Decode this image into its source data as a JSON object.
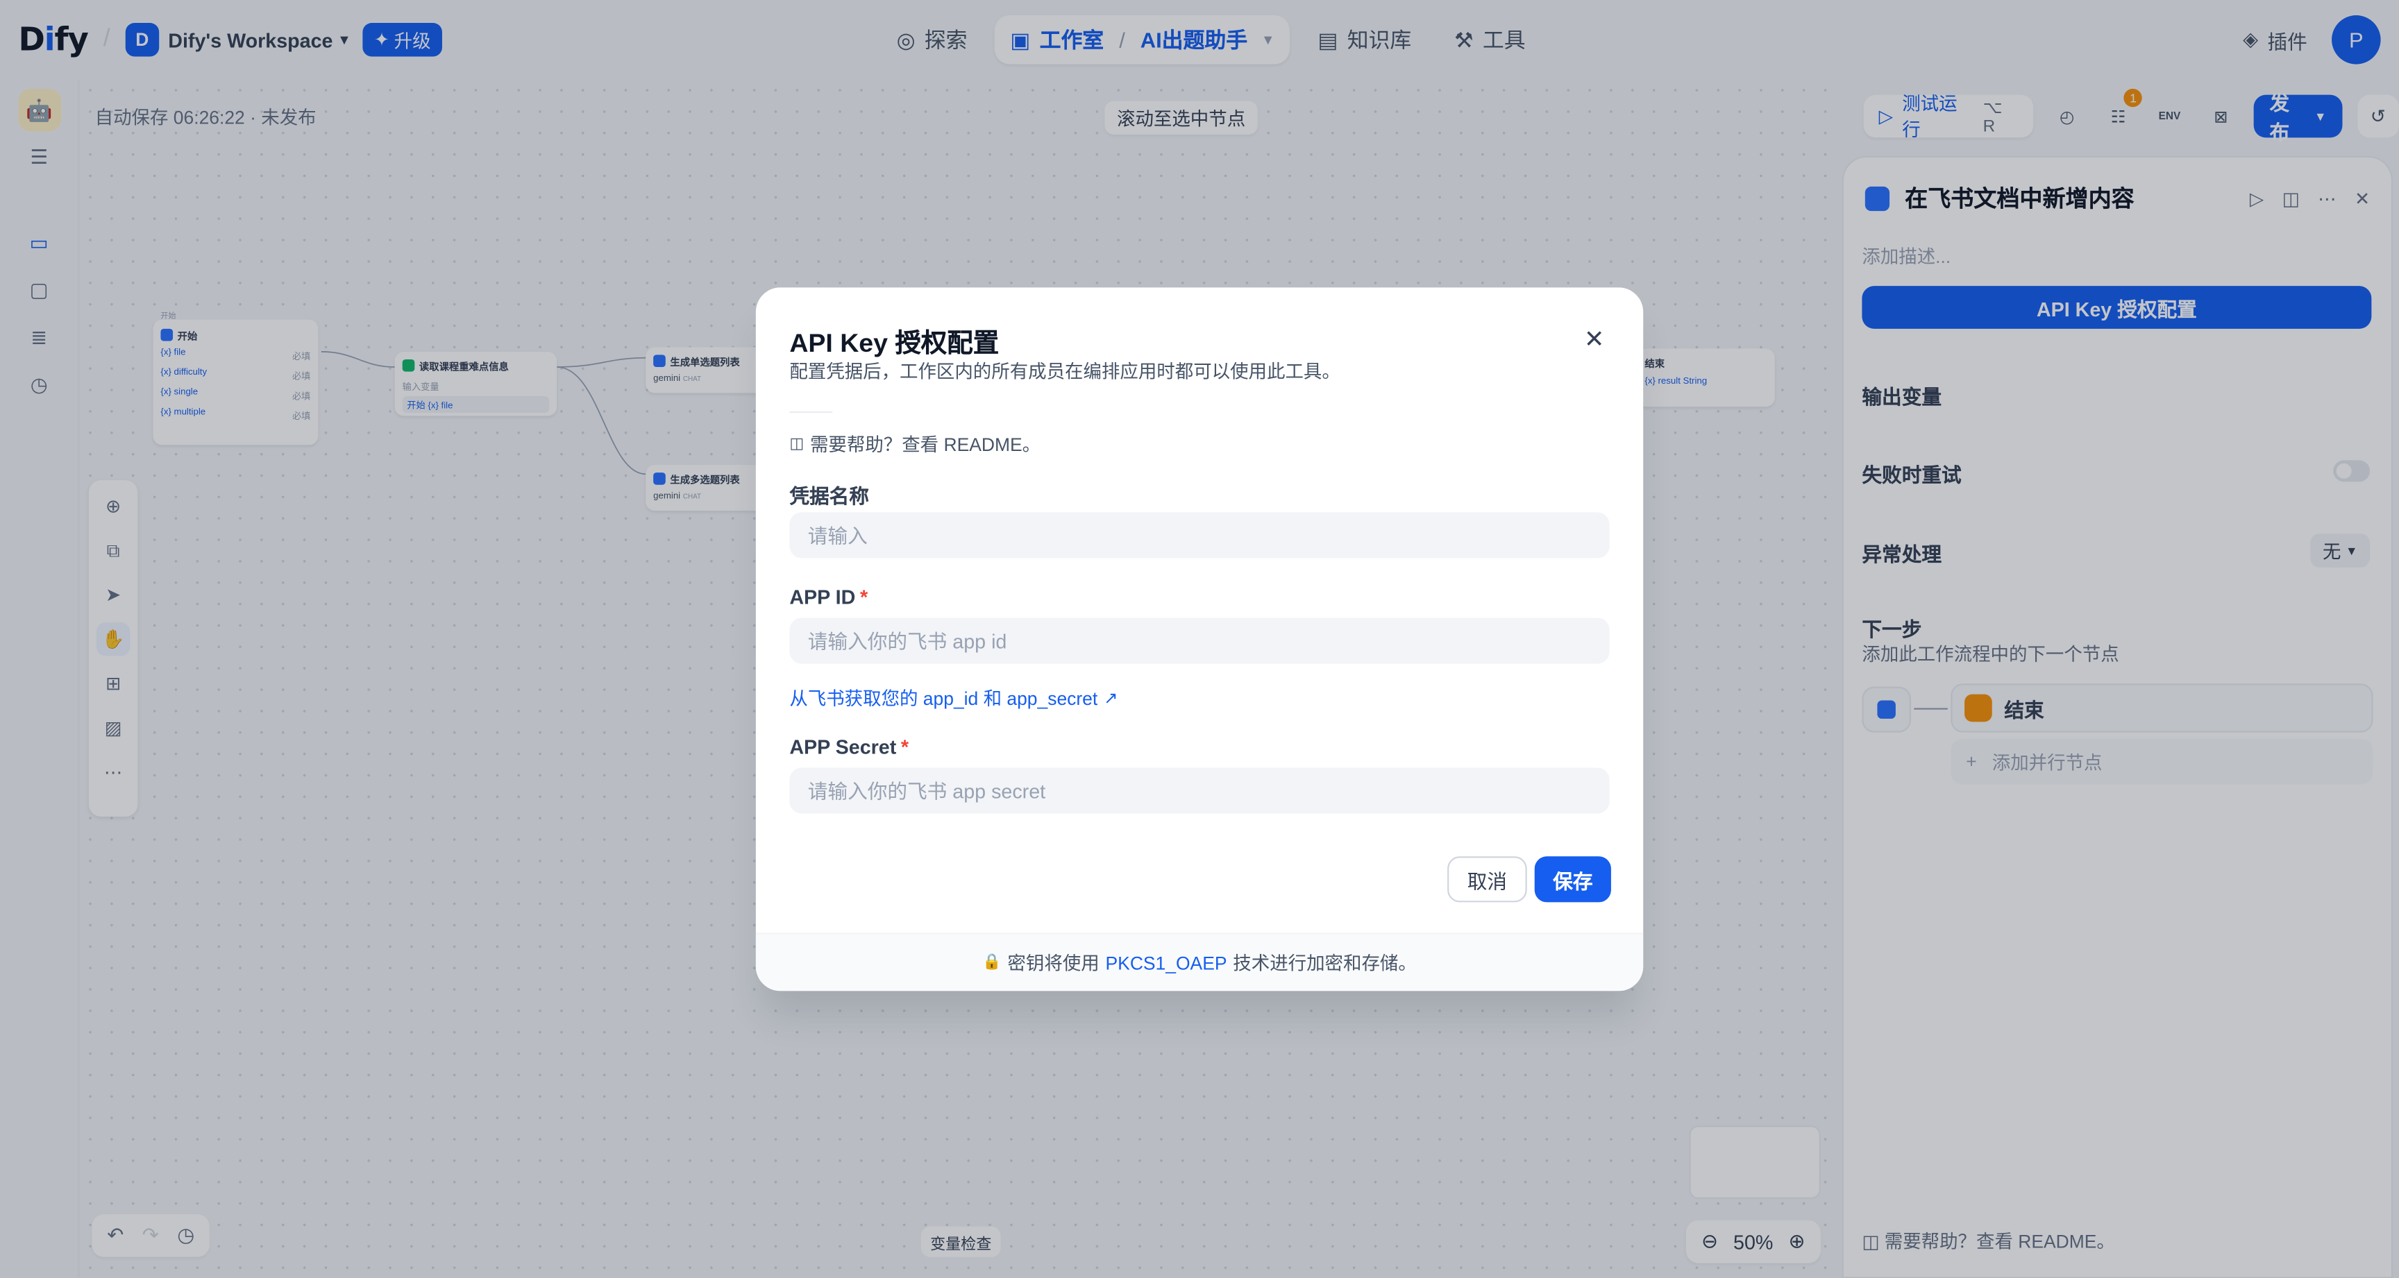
{
  "header": {
    "logo": "Dify",
    "workspace_initial": "D",
    "workspace_name": "Dify's Workspace",
    "upgrade_label": "升级",
    "nav": [
      {
        "label": "探索"
      },
      {
        "label": "工作室",
        "app": "AI出题助手"
      },
      {
        "label": "知识库"
      },
      {
        "label": "工具"
      }
    ],
    "plugins_label": "插件",
    "user_initial": "P"
  },
  "canvas": {
    "autosave": "自动保存 06:26:22 · 未发布",
    "scroll_to_node": "滚动至选中节点",
    "variable_check": "变量检查",
    "zoom_level": "50%",
    "nodes": {
      "start": {
        "title": "开始",
        "header": "开始",
        "vars": [
          "{x} file",
          "{x} difficulty",
          "{x} single",
          "{x} multiple"
        ],
        "tag": "必填"
      },
      "extract": {
        "title": "读取课程重难点信息",
        "sub": "输入变量",
        "var": "开始 {x} file"
      },
      "single": {
        "title": "生成单选题列表",
        "model": "gemini",
        "mode": "CHAT"
      },
      "multi": {
        "title": "生成多选题列表",
        "model": "gemini",
        "mode": "CHAT"
      },
      "end_partial": {
        "title": "结束",
        "var": "{x} result String"
      }
    }
  },
  "run_bar": {
    "test_run": "测试运行",
    "shortcut": "⌥ R",
    "checklist_count": "1",
    "env_label": "ENV",
    "publish": "发布"
  },
  "panel": {
    "title": "在飞书文档中新增内容",
    "desc_placeholder": "添加描述...",
    "auth_button": "API Key 授权配置",
    "output_vars": "输出变量",
    "retry_on_fail": "失败时重试",
    "error_handling": "异常处理",
    "error_handling_value": "无",
    "next_step": "下一步",
    "next_step_desc": "添加此工作流程中的下一个节点",
    "next_node": "结束",
    "add_parallel": "添加并行节点",
    "help": "需要帮助？查看 README。"
  },
  "modal": {
    "title": "API Key 授权配置",
    "desc": "配置凭据后，工作区内的所有成员在编排应用时都可以使用此工具。",
    "help": "需要帮助？查看 README。",
    "cred_name_label": "凭据名称",
    "cred_name_placeholder": "请输入",
    "app_id_label": "APP ID",
    "app_id_placeholder": "请输入你的飞书 app id",
    "link": "从飞书获取您的 app_id 和 app_secret",
    "app_secret_label": "APP Secret",
    "app_secret_placeholder": "请输入你的飞书 app secret",
    "required_mark": "*",
    "cancel": "取消",
    "save": "保存",
    "footer_prefix": "密钥将使用",
    "footer_highlight": "PKCS1_OAEP",
    "footer_suffix": "技术进行加密和存储。"
  },
  "colors": {
    "primary": "#155eef",
    "danger": "#f04438",
    "warning": "#f79009"
  },
  "icons": [
    "compass-icon",
    "robot-icon",
    "book-icon",
    "hammer-icon",
    "cube-icon",
    "close-icon",
    "book-open-icon",
    "external-link-icon",
    "lock-icon",
    "play-icon",
    "history-icon"
  ]
}
